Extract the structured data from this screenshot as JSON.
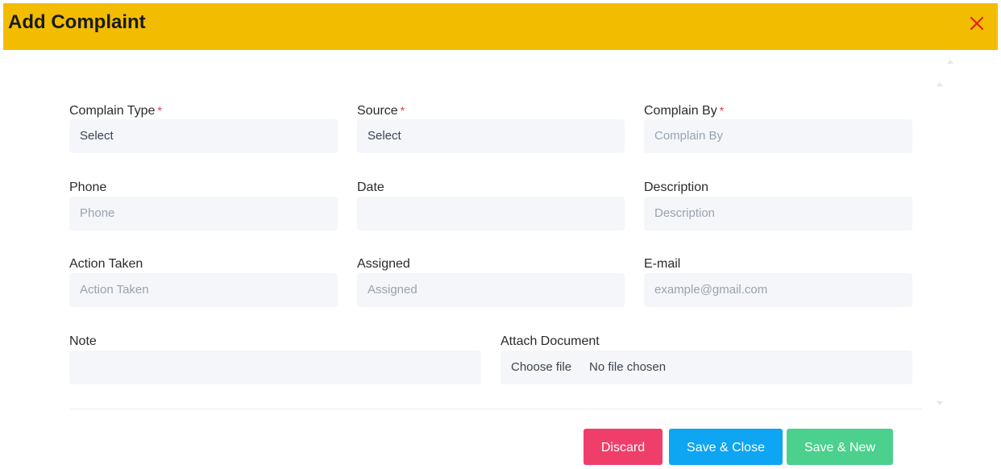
{
  "dialog": {
    "title": "Add Complaint",
    "close_icon": "close-icon",
    "accent_color": "#f2bd00"
  },
  "fields": {
    "complain_type": {
      "label": "Complain Type",
      "required_mark": "*",
      "value": "Select"
    },
    "source": {
      "label": "Source",
      "required_mark": "*",
      "value": "Select"
    },
    "complain_by": {
      "label": "Complain By",
      "required_mark": "*",
      "placeholder": "Complain By"
    },
    "phone": {
      "label": "Phone",
      "placeholder": "Phone"
    },
    "date": {
      "label": "Date",
      "value": ""
    },
    "description": {
      "label": "Description",
      "placeholder": "Description"
    },
    "action_taken": {
      "label": "Action Taken",
      "placeholder": "Action Taken"
    },
    "assigned": {
      "label": "Assigned",
      "placeholder": "Assigned"
    },
    "email": {
      "label": "E-mail",
      "placeholder": "example@gmail.com"
    },
    "note": {
      "label": "Note",
      "value": ""
    },
    "attach_document": {
      "label": "Attach Document",
      "button_label": "Choose file",
      "status": "No file chosen"
    }
  },
  "actions": {
    "discard": {
      "label": "Discard",
      "color": "#f03e6b"
    },
    "save_close": {
      "label": "Save & Close",
      "color": "#0ea5f2"
    },
    "save_new": {
      "label": "Save & New",
      "color": "#4cd08d"
    }
  }
}
